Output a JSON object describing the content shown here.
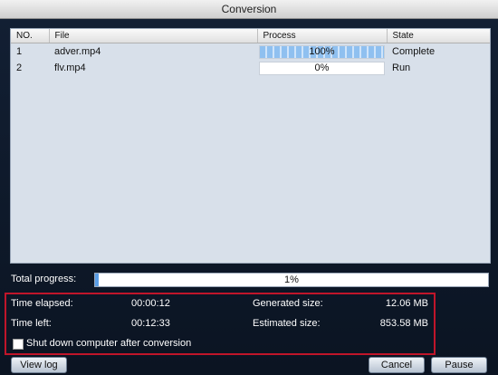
{
  "window": {
    "title": "Conversion"
  },
  "table": {
    "headers": {
      "no": "NO.",
      "file": "File",
      "process": "Process",
      "state": "State"
    },
    "rows": [
      {
        "no": "1",
        "file": "adver.mp4",
        "progress_text": "100%",
        "progress": 1.0,
        "state": "Complete"
      },
      {
        "no": "2",
        "file": "flv.mp4",
        "progress_text": "0%",
        "progress": 0.0,
        "state": "Run"
      }
    ]
  },
  "total": {
    "label": "Total progress:",
    "text": "1%",
    "progress": 0.01
  },
  "stats": {
    "elapsed_label": "Time elapsed:",
    "elapsed_value": "00:00:12",
    "left_label": "Time left:",
    "left_value": "00:12:33",
    "generated_label": "Generated size:",
    "generated_value": "12.06 MB",
    "estimated_label": "Estimated size:",
    "estimated_value": "853.58 MB"
  },
  "shutdown": {
    "label": "Shut down computer after conversion",
    "checked": false
  },
  "buttons": {
    "view_log": "View log",
    "cancel": "Cancel",
    "pause": "Pause"
  }
}
